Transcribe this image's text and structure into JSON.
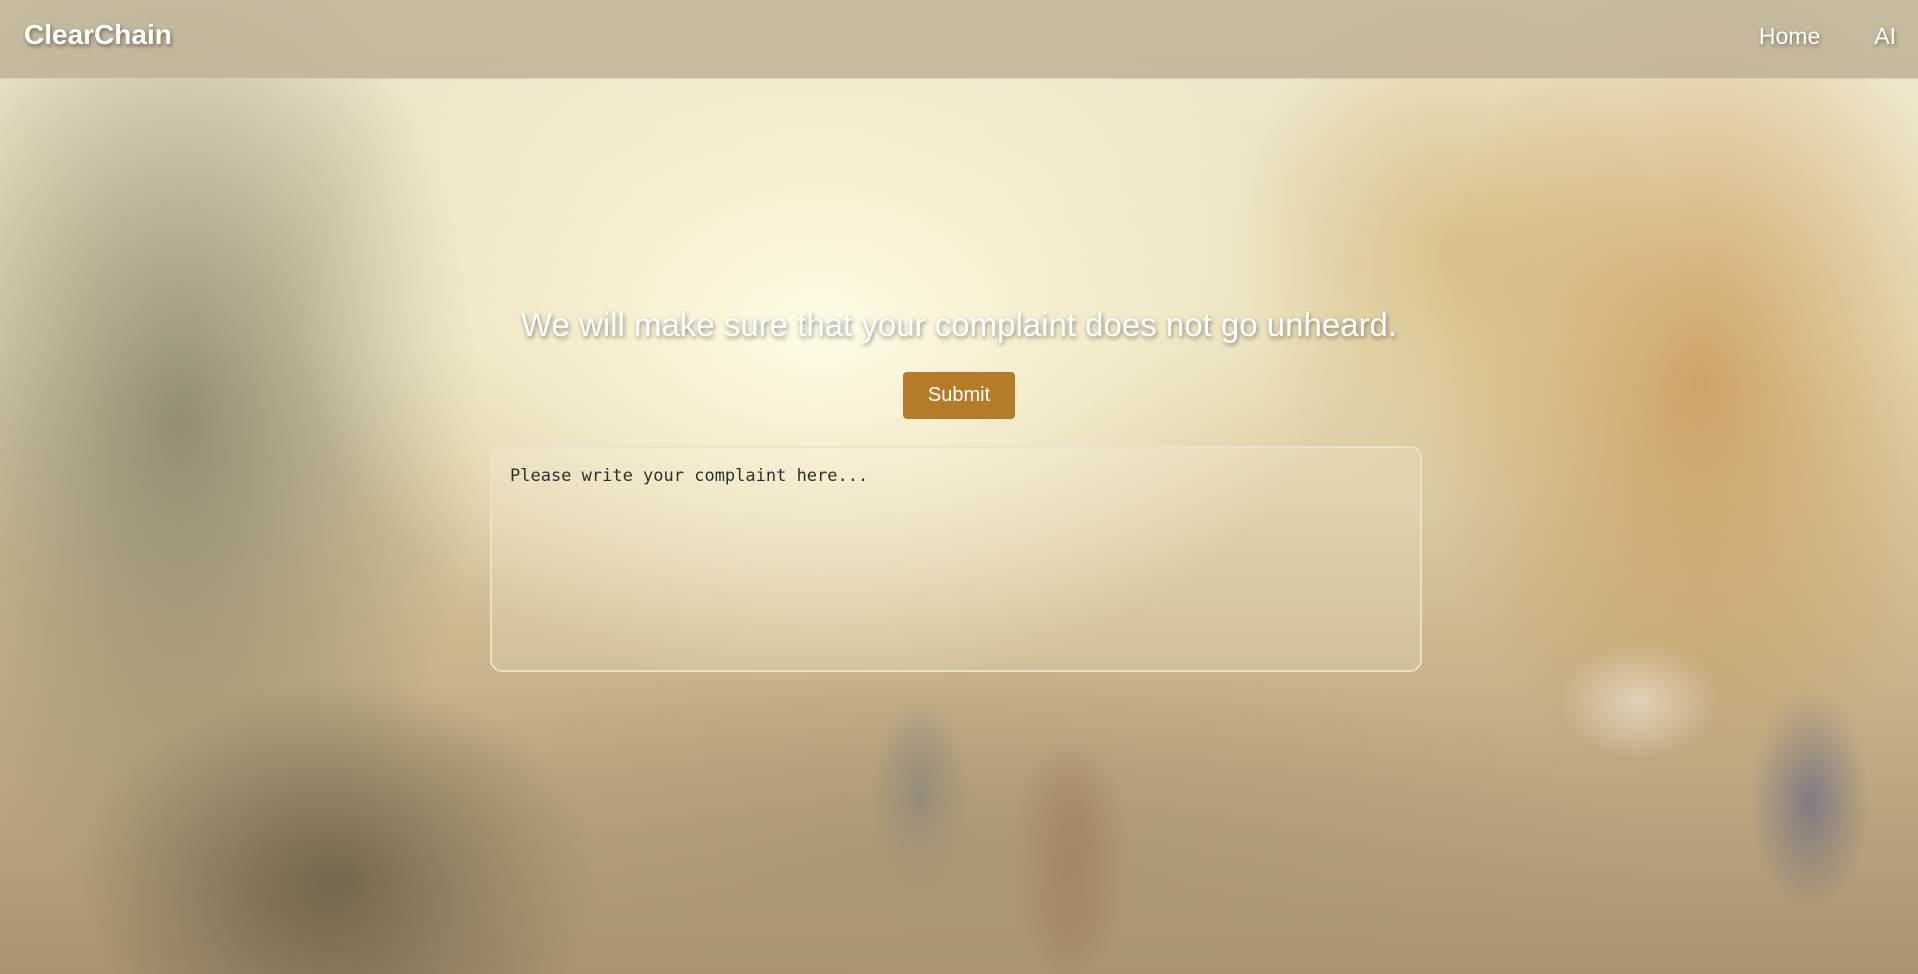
{
  "header": {
    "brand": "ClearChain",
    "nav": [
      {
        "label": "Home"
      },
      {
        "label": "AI"
      }
    ]
  },
  "main": {
    "headline": "We will make sure that your complaint does not go unheard.",
    "submit_label": "Submit",
    "complaint": {
      "placeholder": "Please write your complaint here...",
      "value": ""
    }
  },
  "colors": {
    "accent": "#b47c27",
    "header_bg": "#beb296"
  }
}
